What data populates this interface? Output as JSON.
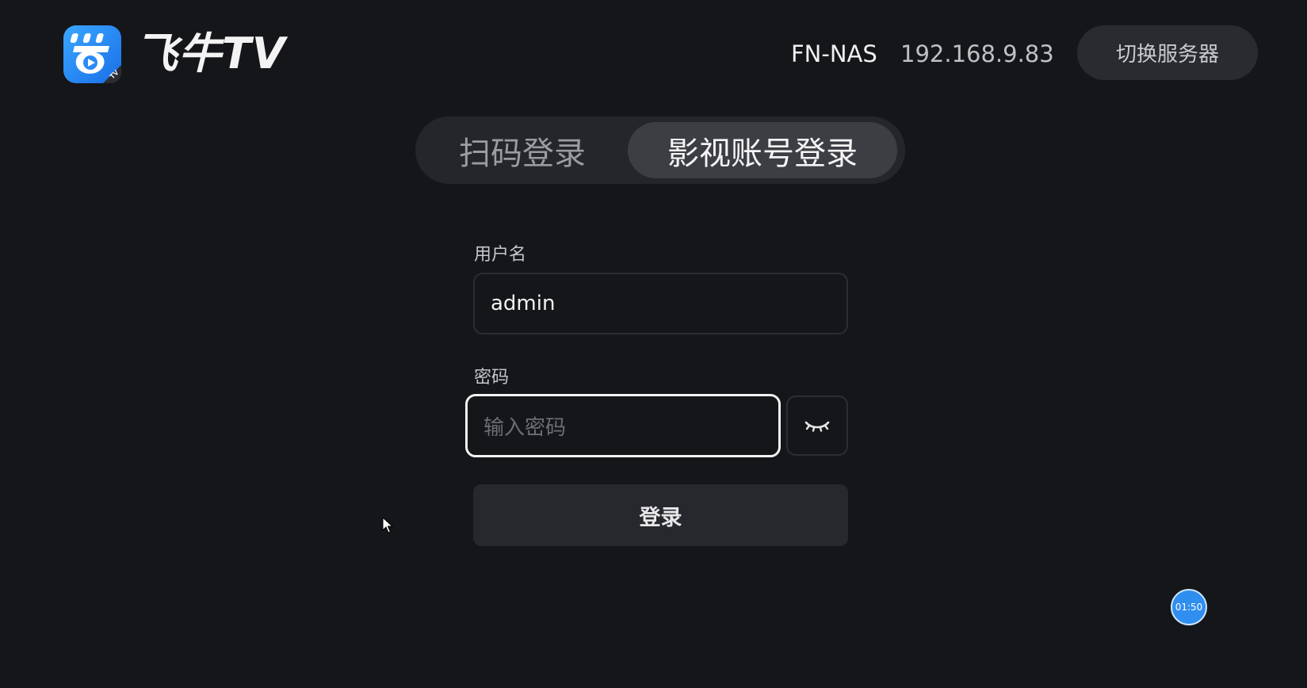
{
  "app": {
    "name": "飞牛TV",
    "logo_icon": "feiniu-tv-logo-icon",
    "logo_badge": "TV"
  },
  "header": {
    "server_name": "FN-NAS",
    "server_ip": "192.168.9.83",
    "switch_server_label": "切换服务器"
  },
  "tabs": [
    {
      "label": "扫码登录",
      "active": false
    },
    {
      "label": "影视账号登录",
      "active": true
    }
  ],
  "form": {
    "username_label": "用户名",
    "username_value": "admin",
    "password_label": "密码",
    "password_placeholder": "输入密码",
    "password_value": "",
    "toggle_visibility_icon": "eye-closed-icon",
    "submit_label": "登录"
  },
  "overlay": {
    "timer_text": "01:50"
  },
  "colors": {
    "background": "#15161a",
    "accent_blue": "#2f8ef0",
    "focus_border": "#f3f3f4",
    "surface": "#27282d"
  }
}
